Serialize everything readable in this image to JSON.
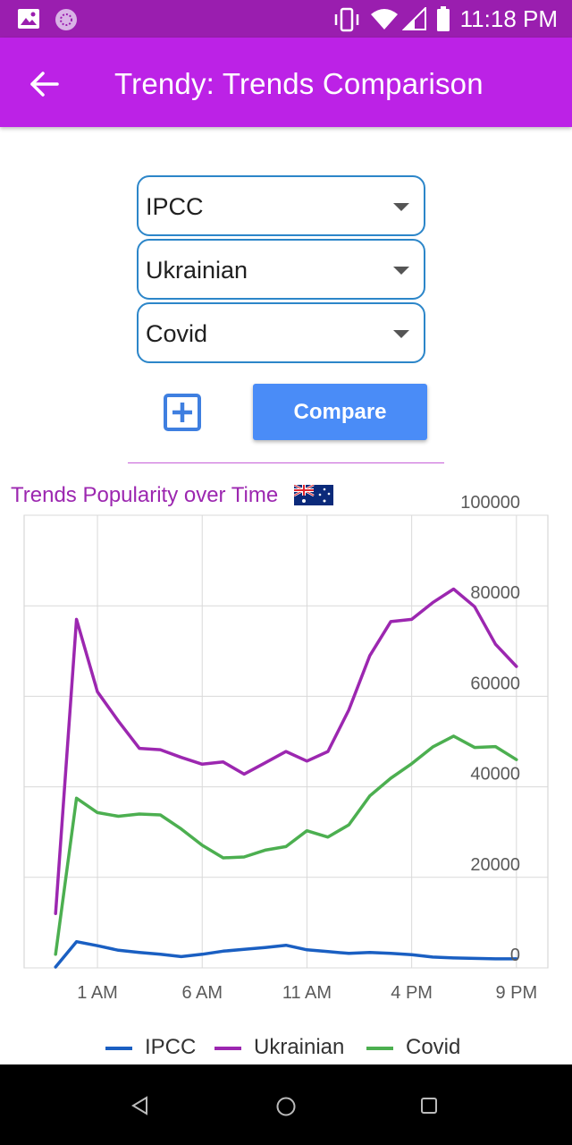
{
  "status_bar": {
    "time": "11:18 PM"
  },
  "app_bar": {
    "title": "Trendy: Trends Comparison"
  },
  "dropdowns": [
    {
      "value": "IPCC"
    },
    {
      "value": "Ukrainian"
    },
    {
      "value": "Covid"
    }
  ],
  "compare_label": "Compare",
  "chart_title": "Trends Popularity over Time",
  "colors": {
    "status_bar": "#9A1EAF",
    "app_bar": "#BC22E6",
    "button": "#4A8CF7",
    "dropdown_border": "#2C86C9"
  },
  "chart_data": {
    "type": "line",
    "title": "Trends Popularity over Time",
    "x_tick_labels": [
      "1 AM",
      "6 AM",
      "11 AM",
      "4 PM",
      "9 PM"
    ],
    "x_ticks": [
      1,
      6,
      11,
      16,
      21
    ],
    "x": [
      -1,
      0,
      1,
      2,
      3,
      4,
      5,
      6,
      7,
      8,
      9,
      10,
      11,
      12,
      13,
      14,
      15,
      16,
      17,
      18,
      19,
      20,
      21
    ],
    "y_ticks": [
      0,
      20000,
      40000,
      60000,
      80000,
      100000
    ],
    "ylim": [
      0,
      100000
    ],
    "xlim": [
      -2.5,
      22.5
    ],
    "grid": true,
    "legend_position": "bottom",
    "series": [
      {
        "name": "IPCC",
        "color": "#1A5FC2",
        "values": [
          200,
          5800,
          4900,
          3900,
          3400,
          3000,
          2500,
          3000,
          3700,
          4100,
          4500,
          5000,
          4000,
          3600,
          3200,
          3400,
          3200,
          2900,
          2400,
          2200,
          2100,
          2000,
          2000
        ]
      },
      {
        "name": "Ukrainian",
        "color": "#9C27B0",
        "values": [
          12000,
          77000,
          61000,
          54500,
          48500,
          48200,
          46500,
          45000,
          45500,
          42800,
          45300,
          47800,
          45700,
          47800,
          57000,
          69000,
          76500,
          77000,
          80700,
          83700,
          79800,
          71500,
          66600
        ]
      },
      {
        "name": "Covid",
        "color": "#4CAF50",
        "values": [
          3000,
          37500,
          34300,
          33500,
          34000,
          33800,
          30700,
          27100,
          24300,
          24500,
          26000,
          26800,
          30300,
          28900,
          31600,
          38000,
          41900,
          45100,
          48800,
          51200,
          48700,
          48900,
          46000
        ]
      }
    ]
  }
}
